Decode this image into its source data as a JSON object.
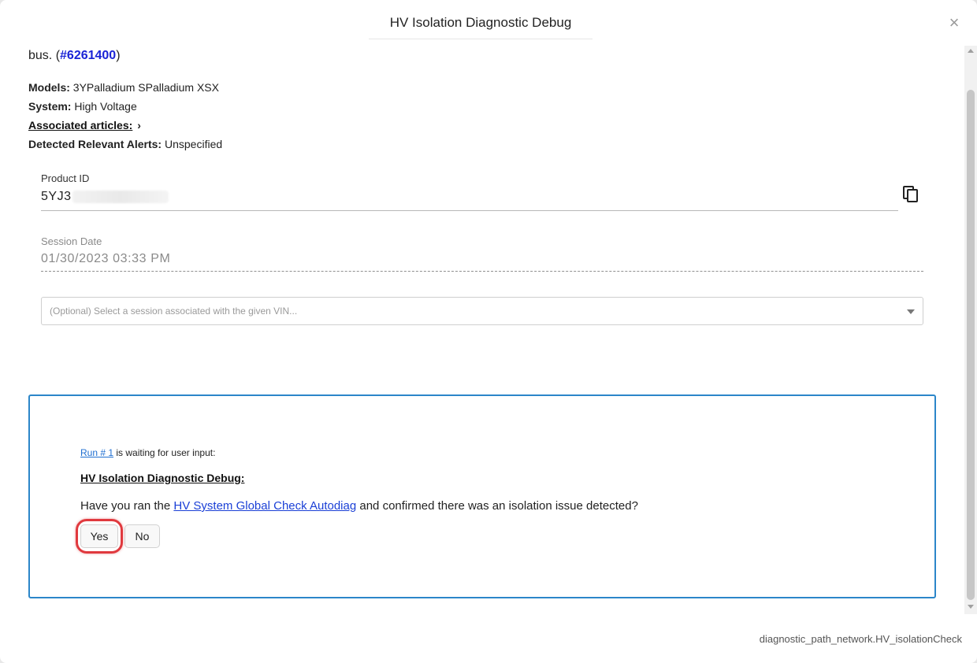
{
  "dialog": {
    "title": "HV Isolation Diagnostic Debug",
    "close_glyph": "×"
  },
  "summary": {
    "prefix": "bus. (",
    "ticket_link": "#6261400",
    "suffix": ")"
  },
  "meta": {
    "models_label": "Models:",
    "models_value": "3YPalladium SPalladium XSX",
    "system_label": "System:",
    "system_value": "High Voltage",
    "articles_label": "Associated articles:",
    "articles_chevron": "›",
    "alerts_label": "Detected Relevant Alerts:",
    "alerts_value": "Unspecified"
  },
  "product": {
    "label": "Product ID",
    "value": "5YJ3",
    "copy_icon": "copy-icon"
  },
  "session": {
    "label": "Session Date",
    "value": "01/30/2023 03:33 PM",
    "select_placeholder": "(Optional) Select a session associated with the given VIN..."
  },
  "input_panel": {
    "run_link": "Run # 1",
    "run_suffix": " is waiting for user input:",
    "prompt_title": "HV Isolation Diagnostic Debug:",
    "question_prefix": "Have you ran the ",
    "question_link": "HV System Global Check Autodiag",
    "question_suffix": " and confirmed there was an isolation issue detected?",
    "yes_label": "Yes",
    "no_label": "No",
    "highlight_color": "#e0393e",
    "border_color": "#2b86c9"
  },
  "footer": {
    "path": "diagnostic_path_network.HV_isolationCheck"
  }
}
